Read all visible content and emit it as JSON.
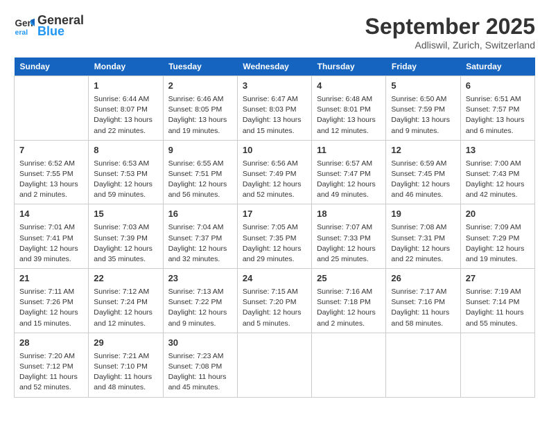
{
  "header": {
    "logo_general": "General",
    "logo_blue": "Blue",
    "month_title": "September 2025",
    "location": "Adliswil, Zurich, Switzerland"
  },
  "days_of_week": [
    "Sunday",
    "Monday",
    "Tuesday",
    "Wednesday",
    "Thursday",
    "Friday",
    "Saturday"
  ],
  "weeks": [
    [
      {
        "day": "",
        "content": ""
      },
      {
        "day": "1",
        "content": "Sunrise: 6:44 AM\nSunset: 8:07 PM\nDaylight: 13 hours\nand 22 minutes."
      },
      {
        "day": "2",
        "content": "Sunrise: 6:46 AM\nSunset: 8:05 PM\nDaylight: 13 hours\nand 19 minutes."
      },
      {
        "day": "3",
        "content": "Sunrise: 6:47 AM\nSunset: 8:03 PM\nDaylight: 13 hours\nand 15 minutes."
      },
      {
        "day": "4",
        "content": "Sunrise: 6:48 AM\nSunset: 8:01 PM\nDaylight: 13 hours\nand 12 minutes."
      },
      {
        "day": "5",
        "content": "Sunrise: 6:50 AM\nSunset: 7:59 PM\nDaylight: 13 hours\nand 9 minutes."
      },
      {
        "day": "6",
        "content": "Sunrise: 6:51 AM\nSunset: 7:57 PM\nDaylight: 13 hours\nand 6 minutes."
      }
    ],
    [
      {
        "day": "7",
        "content": "Sunrise: 6:52 AM\nSunset: 7:55 PM\nDaylight: 13 hours\nand 2 minutes."
      },
      {
        "day": "8",
        "content": "Sunrise: 6:53 AM\nSunset: 7:53 PM\nDaylight: 12 hours\nand 59 minutes."
      },
      {
        "day": "9",
        "content": "Sunrise: 6:55 AM\nSunset: 7:51 PM\nDaylight: 12 hours\nand 56 minutes."
      },
      {
        "day": "10",
        "content": "Sunrise: 6:56 AM\nSunset: 7:49 PM\nDaylight: 12 hours\nand 52 minutes."
      },
      {
        "day": "11",
        "content": "Sunrise: 6:57 AM\nSunset: 7:47 PM\nDaylight: 12 hours\nand 49 minutes."
      },
      {
        "day": "12",
        "content": "Sunrise: 6:59 AM\nSunset: 7:45 PM\nDaylight: 12 hours\nand 46 minutes."
      },
      {
        "day": "13",
        "content": "Sunrise: 7:00 AM\nSunset: 7:43 PM\nDaylight: 12 hours\nand 42 minutes."
      }
    ],
    [
      {
        "day": "14",
        "content": "Sunrise: 7:01 AM\nSunset: 7:41 PM\nDaylight: 12 hours\nand 39 minutes."
      },
      {
        "day": "15",
        "content": "Sunrise: 7:03 AM\nSunset: 7:39 PM\nDaylight: 12 hours\nand 35 minutes."
      },
      {
        "day": "16",
        "content": "Sunrise: 7:04 AM\nSunset: 7:37 PM\nDaylight: 12 hours\nand 32 minutes."
      },
      {
        "day": "17",
        "content": "Sunrise: 7:05 AM\nSunset: 7:35 PM\nDaylight: 12 hours\nand 29 minutes."
      },
      {
        "day": "18",
        "content": "Sunrise: 7:07 AM\nSunset: 7:33 PM\nDaylight: 12 hours\nand 25 minutes."
      },
      {
        "day": "19",
        "content": "Sunrise: 7:08 AM\nSunset: 7:31 PM\nDaylight: 12 hours\nand 22 minutes."
      },
      {
        "day": "20",
        "content": "Sunrise: 7:09 AM\nSunset: 7:29 PM\nDaylight: 12 hours\nand 19 minutes."
      }
    ],
    [
      {
        "day": "21",
        "content": "Sunrise: 7:11 AM\nSunset: 7:26 PM\nDaylight: 12 hours\nand 15 minutes."
      },
      {
        "day": "22",
        "content": "Sunrise: 7:12 AM\nSunset: 7:24 PM\nDaylight: 12 hours\nand 12 minutes."
      },
      {
        "day": "23",
        "content": "Sunrise: 7:13 AM\nSunset: 7:22 PM\nDaylight: 12 hours\nand 9 minutes."
      },
      {
        "day": "24",
        "content": "Sunrise: 7:15 AM\nSunset: 7:20 PM\nDaylight: 12 hours\nand 5 minutes."
      },
      {
        "day": "25",
        "content": "Sunrise: 7:16 AM\nSunset: 7:18 PM\nDaylight: 12 hours\nand 2 minutes."
      },
      {
        "day": "26",
        "content": "Sunrise: 7:17 AM\nSunset: 7:16 PM\nDaylight: 11 hours\nand 58 minutes."
      },
      {
        "day": "27",
        "content": "Sunrise: 7:19 AM\nSunset: 7:14 PM\nDaylight: 11 hours\nand 55 minutes."
      }
    ],
    [
      {
        "day": "28",
        "content": "Sunrise: 7:20 AM\nSunset: 7:12 PM\nDaylight: 11 hours\nand 52 minutes."
      },
      {
        "day": "29",
        "content": "Sunrise: 7:21 AM\nSunset: 7:10 PM\nDaylight: 11 hours\nand 48 minutes."
      },
      {
        "day": "30",
        "content": "Sunrise: 7:23 AM\nSunset: 7:08 PM\nDaylight: 11 hours\nand 45 minutes."
      },
      {
        "day": "",
        "content": ""
      },
      {
        "day": "",
        "content": ""
      },
      {
        "day": "",
        "content": ""
      },
      {
        "day": "",
        "content": ""
      }
    ]
  ]
}
